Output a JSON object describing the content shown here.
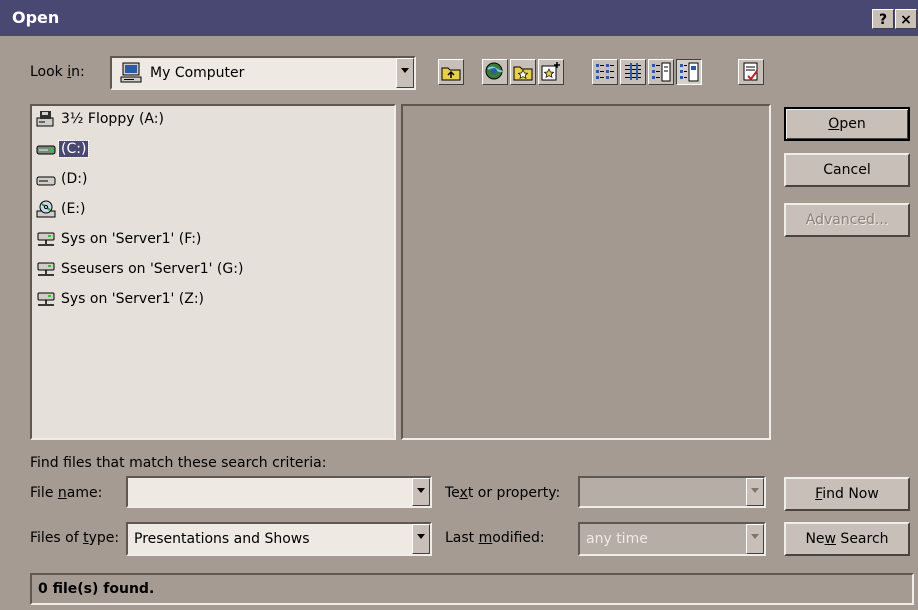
{
  "window": {
    "title": "Open",
    "help_label": "?",
    "close_label": "×"
  },
  "lookin": {
    "label_pre": "Look ",
    "label_u": "i",
    "label_post": "n:",
    "value": "My Computer"
  },
  "toolbar": {
    "icons": [
      "up-one-level-icon",
      "search-web-icon",
      "look-in-favorites-icon",
      "add-to-favorites-icon",
      "list-view-icon",
      "details-view-icon",
      "properties-view-icon",
      "preview-view-icon",
      "commands-icon"
    ]
  },
  "drives": [
    {
      "label": "3½ Floppy (A:)",
      "icon": "floppy-drive-icon"
    },
    {
      "label": "(C:)",
      "icon": "hard-drive-icon",
      "selected": true
    },
    {
      "label": "(D:)",
      "icon": "hard-drive-icon"
    },
    {
      "label": "(E:)",
      "icon": "cd-drive-icon"
    },
    {
      "label": "Sys on 'Server1' (F:)",
      "icon": "network-drive-icon"
    },
    {
      "label": "Sseusers on 'Server1' (G:)",
      "icon": "network-drive-icon"
    },
    {
      "label": "Sys on 'Server1' (Z:)",
      "icon": "network-drive-icon"
    }
  ],
  "buttons": {
    "open_u": "O",
    "open_rest": "pen",
    "cancel": "Cancel",
    "advanced": "Advanced...",
    "find_u": "F",
    "find_rest": "ind Now",
    "new_pre": "Ne",
    "new_u": "w",
    "new_post": " Search"
  },
  "search": {
    "criteria_label": "Find files that match these search criteria:",
    "filename_pre": "File ",
    "filename_u": "n",
    "filename_post": "ame:",
    "filename_value": "",
    "filetype_pre": "Files of ",
    "filetype_u": "t",
    "filetype_post": "ype:",
    "filetype_value": "Presentations and Shows",
    "text_pre": "Te",
    "text_u": "x",
    "text_post": "t or property:",
    "text_value": "",
    "modified_pre": "Last ",
    "modified_u": "m",
    "modified_post": "odified:",
    "modified_value": "any time"
  },
  "status": {
    "text": "0 file(s) found."
  }
}
